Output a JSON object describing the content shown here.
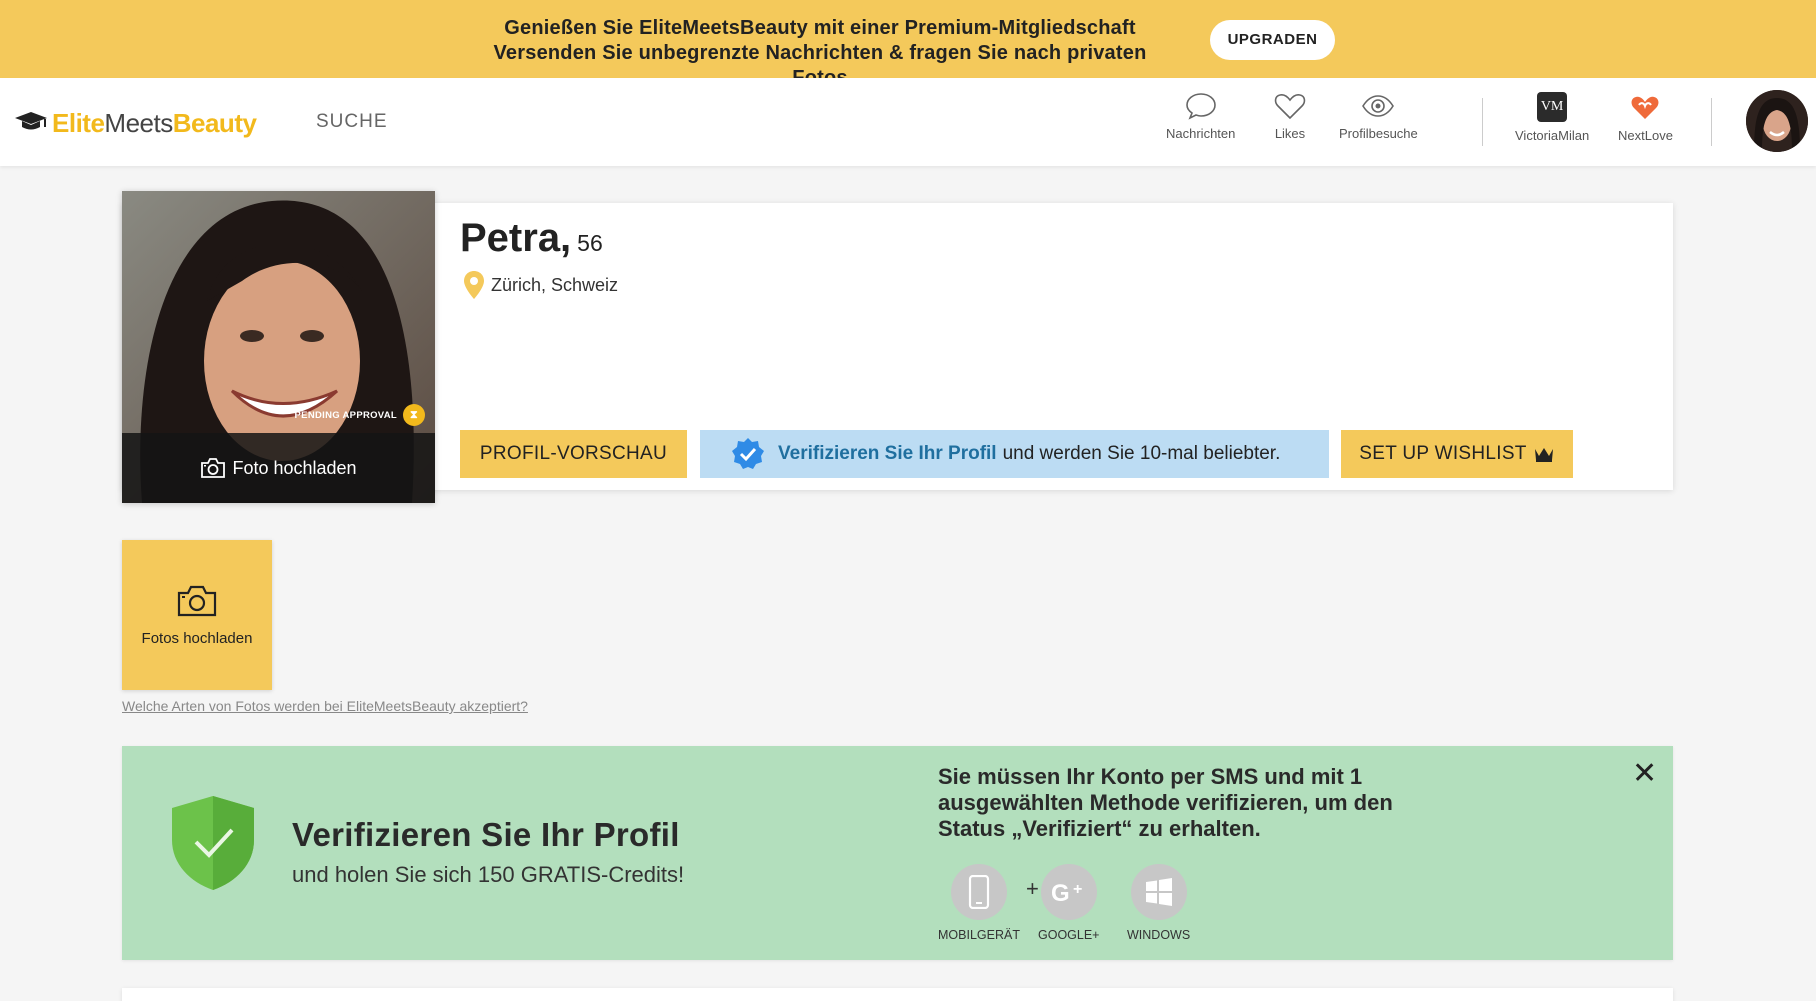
{
  "promo": {
    "line1": "Genießen Sie EliteMeetsBeauty mit einer Premium-Mitgliedschaft",
    "line2": "Versenden Sie unbegrenzte Nachrichten & fragen Sie nach privaten Fotos",
    "upgrade_label": "UPGRADEN"
  },
  "nav": {
    "logo": {
      "elite": "Elite",
      "meets": "Meets",
      "beauty": "Beauty"
    },
    "search_label": "SUCHE",
    "items": [
      {
        "label": "Nachrichten",
        "icon": "chat-icon"
      },
      {
        "label": "Likes",
        "icon": "heart-icon"
      },
      {
        "label": "Profilbesuche",
        "icon": "eye-icon"
      }
    ],
    "partners": [
      {
        "label": "VictoriaMilan",
        "icon": "victoriamilan-icon",
        "badge": "VM"
      },
      {
        "label": "NextLove",
        "icon": "nextlove-icon"
      }
    ]
  },
  "profile": {
    "name": "Petra,",
    "age": "56",
    "location": "Zürich, Schweiz",
    "pending_label": "PENDING APPROVAL",
    "upload_photo_label": "Foto hochladen",
    "preview_button": "PROFIL-VORSCHAU",
    "verify_strong": "Verifizieren Sie Ihr Profil",
    "verify_rest": "und werden Sie 10-mal beliebter.",
    "wishlist_button": "SET UP WISHLIST"
  },
  "photos": {
    "upload_tile_label": "Fotos hochladen",
    "help_link": "Welche Arten von Fotos werden bei EliteMeetsBeauty akzeptiert?"
  },
  "verify_panel": {
    "title": "Verifizieren Sie Ihr Profil",
    "subtitle": "und holen Sie sich 150 GRATIS-Credits!",
    "instructions": "Sie müssen Ihr Konto per SMS und mit 1 ausgewählten Methode verifizieren, um den Status „Verifiziert“ zu erhalten.",
    "plus": "+",
    "methods": [
      {
        "label": "MOBILGERÄT",
        "icon": "mobile-icon"
      },
      {
        "label": "GOOGLE+",
        "icon": "google-plus-icon"
      },
      {
        "label": "WINDOWS",
        "icon": "windows-icon"
      }
    ]
  },
  "colors": {
    "brand_yellow": "#f4c95b",
    "verify_blue": "#bcdcf3",
    "verify_green": "#b3dfbd",
    "link_blue": "#1f6f9f"
  }
}
